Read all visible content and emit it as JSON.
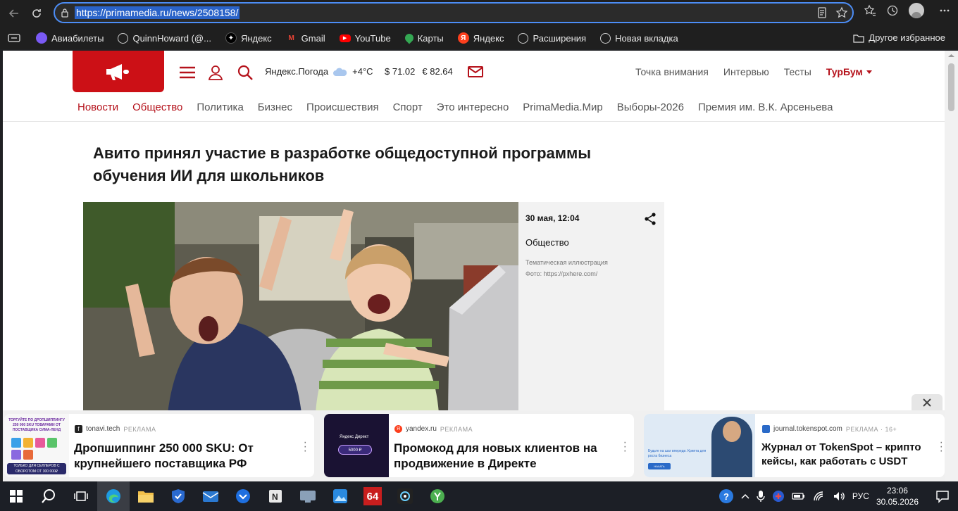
{
  "browser": {
    "url": "https://primamedia.ru/news/2508158/",
    "bookmarks": [
      {
        "label": "Авиабилеты",
        "icon": "aviasales-icon",
        "color": "#7a5af5"
      },
      {
        "label": "QuinnHoward (@...",
        "icon": "globe-icon",
        "color": "#888888"
      },
      {
        "label": "Яндекс",
        "icon": "sparkle-icon",
        "color": "#ffffff"
      },
      {
        "label": "Gmail",
        "icon": "gmail-icon",
        "color": "#ea4335"
      },
      {
        "label": "YouTube",
        "icon": "youtube-icon",
        "color": "#ff0000"
      },
      {
        "label": "Карты",
        "icon": "maps-pin-icon",
        "color": "#34a853"
      },
      {
        "label": "Яндекс",
        "icon": "yandex-icon",
        "color": "#fc3f1d"
      },
      {
        "label": "Расширения",
        "icon": "globe-icon",
        "color": "#888888"
      },
      {
        "label": "Новая вкладка",
        "icon": "globe-icon",
        "color": "#888888"
      }
    ],
    "other_favorites": "Другое избранное"
  },
  "site": {
    "brand_color": "#cc1016",
    "weather_label": "Яндекс.Погода",
    "temperature": "+4°C",
    "usd": "$ 71.02",
    "eur": "€ 82.64",
    "top_links": [
      "Точка внимания",
      "Интервью",
      "Тесты"
    ],
    "turbum": "ТурБум",
    "main_nav": [
      "Новости",
      "Общество",
      "Политика",
      "Бизнес",
      "Происшествия",
      "Спорт",
      "Это интересно",
      "PrimaMedia.Мир",
      "Выборы-2026",
      "Премия им. В.К. Арсеньева"
    ]
  },
  "article": {
    "headline": "Авито принял участие в разработке общедоступной программы обучения ИИ для школьников",
    "date": "30 мая, 12:04",
    "rubric": "Общество",
    "caption": "Тематическая иллюстрация",
    "photo_credit": "Фото: https://pxhere.com/"
  },
  "ads": [
    {
      "source": "tonavi.tech",
      "tag": "РЕКЛАМА",
      "title": "Дропшиппинг 250 000 SKU: От крупнейшего поставщика РФ",
      "thumb_text": "ТОРГУЙТЕ ПО ДРОПШИППИНГУ 250 000 SKU ТОВАРАМИ ОТ ПОСТАВЩИКА СИМА-ЛЕНД",
      "thumb_foot": "ТОЛЬКО ДЛЯ СЕЛЛЕРОВ С ОБОРОТОМ ОТ 300 000₽"
    },
    {
      "source": "yandex.ru",
      "tag": "РЕКЛАМА",
      "title": "Промокод для новых клиентов на продвижение в Директе",
      "thumb_text": "Яндекс Директ",
      "thumb_badge": "5000 ₽"
    },
    {
      "source": "journal.tokenspot.com",
      "tag": "РЕКЛАМА · 16+",
      "title": "Журнал от TokenSpot – крипто кейсы, как работать с USDT",
      "thumb_text": "Будьте на шаг впереди. Крипта для роста бизнеса",
      "thumb_button": "НАЧАТЬ"
    }
  ],
  "taskbar": {
    "language": "РУС",
    "time": "23:06",
    "date": "30.05.2026",
    "badge_64": "64"
  }
}
